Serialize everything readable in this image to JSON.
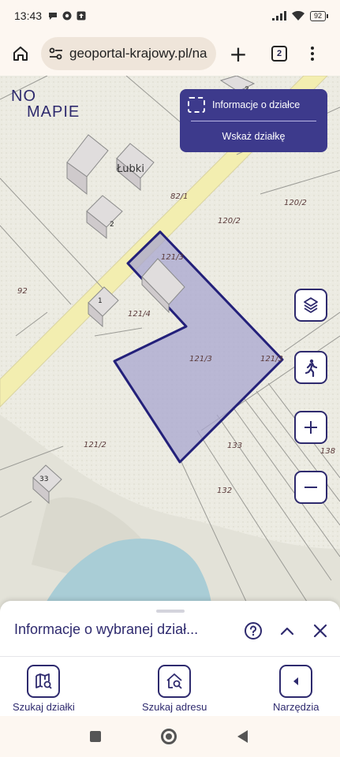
{
  "status_bar": {
    "time": "13:43",
    "battery": "92"
  },
  "browser": {
    "url": "geoportal-krajowy.pl/na",
    "tab_count": "2"
  },
  "map": {
    "logo": [
      "NO",
      "MAPIE"
    ],
    "info_panel": {
      "parcel_info_label": "Informacje o działce",
      "show_parcel_label": "Wskaż działkę"
    },
    "place_name": "Łubki",
    "building_numbers": [
      "2",
      "1",
      "33",
      "3"
    ],
    "parcel_labels": [
      "82/1",
      "120/2",
      "120/2",
      "121/3",
      "121/4",
      "121/3",
      "121/3",
      "92",
      "121/2",
      "133",
      "132",
      "138"
    ]
  },
  "bottom_sheet": {
    "title": "Informacje o wybranej dział..."
  },
  "bottom_nav": {
    "items": [
      {
        "label": "Szukaj działki"
      },
      {
        "label": "Szukaj adresu"
      },
      {
        "label": "Narzędzia"
      }
    ]
  },
  "colors": {
    "accent": "#2e2a6e",
    "panel": "#3d3a8c",
    "parcel_fill": "#a8a6cf",
    "road": "#f3eeb0",
    "water": "#a9cdd6"
  }
}
